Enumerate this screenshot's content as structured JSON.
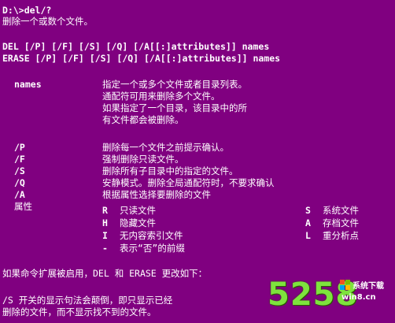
{
  "colors": {
    "background": "#800080",
    "text": "#ffffff",
    "logo_green": "#7ee33d"
  },
  "prompt": "D:\\>del/?",
  "description": "删除一个或数个文件。",
  "syntax": [
    "DEL [/P] [/F] [/S] [/Q] [/A[[:]attributes]] names",
    "ERASE [/P] [/F] [/S] [/Q] [/A[[:]attributes]] names"
  ],
  "names": {
    "label": "names",
    "lines": [
      "指定一个或多个文件或者目录列表。",
      "通配符可用来删除多个文件。",
      "如果指定了一个目录，该目录中的所",
      "有文件都会被删除。"
    ]
  },
  "options": [
    {
      "switch": "/P",
      "text": "删除每一个文件之前提示确认。"
    },
    {
      "switch": "/F",
      "text": "强制删除只读文件。"
    },
    {
      "switch": "/S",
      "text": "删除所有子目录中的指定的文件。"
    },
    {
      "switch": "/Q",
      "text": "安静模式。删除全局通配符时，不要求确认"
    },
    {
      "switch": "/A",
      "text": "根据属性选择要删除的文件"
    }
  ],
  "attributes": {
    "label": "属性",
    "rows": [
      {
        "k1": "R",
        "v1": "只读文件",
        "k2": "S",
        "v2": "系统文件"
      },
      {
        "k1": "H",
        "v1": "隐藏文件",
        "k2": "A",
        "v2": "存档文件"
      },
      {
        "k1": "I",
        "v1": "无内容索引文件",
        "k2": "L",
        "v2": "重分析点"
      },
      {
        "k1": "-",
        "v1": "表示“否”的前缀",
        "k2": "",
        "v2": ""
      }
    ]
  },
  "ext_note": "如果命令扩展被启用，DEL 和 ERASE 更改如下：",
  "ext_lines": [
    "/S 开关的显示句法会颠倒，即只显示已经",
    "删除的文件，而不显示找不到的文件。"
  ],
  "watermark": {
    "number": "5258",
    "site": "系统下载",
    "url": "win8.cn"
  }
}
